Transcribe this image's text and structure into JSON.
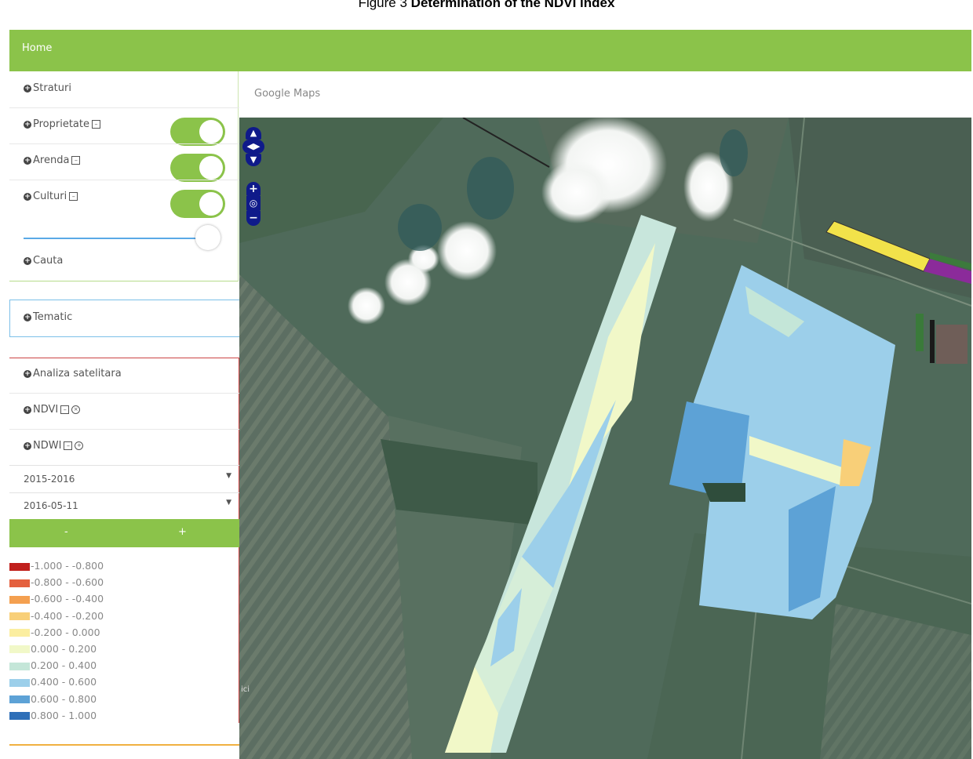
{
  "caption": {
    "prefix": "Figure 3",
    "title": "Determination of the NDVI index"
  },
  "navbar": {
    "home": "Home"
  },
  "sidebar": {
    "straturi": "Straturi",
    "layers": [
      {
        "label": "Proprietate",
        "on": true
      },
      {
        "label": "Arenda",
        "on": true
      },
      {
        "label": "Culturi",
        "on": true
      }
    ],
    "cauta": "Cauta",
    "tematic": "Tematic",
    "analiza": "Analiza satelitara",
    "indices": [
      {
        "label": "NDVI"
      },
      {
        "label": "NDWI"
      }
    ],
    "season": "2015-2016",
    "date": "2016-05-11",
    "btn_minus": "-",
    "btn_plus": "+"
  },
  "legend": [
    {
      "range": "-1.000 - -0.800",
      "color": "#c0201c"
    },
    {
      "range": "-0.800 - -0.600",
      "color": "#e4603e"
    },
    {
      "range": "-0.600 - -0.400",
      "color": "#f4a050"
    },
    {
      "range": "-0.400 - -0.200",
      "color": "#f8cf78"
    },
    {
      "range": "-0.200 - 0.000",
      "color": "#fbeea0"
    },
    {
      "range": "0.000 - 0.200",
      "color": "#f1f8c8"
    },
    {
      "range": "0.200 - 0.400",
      "color": "#c4e6d8"
    },
    {
      "range": "0.400 - 0.600",
      "color": "#9ccfea"
    },
    {
      "range": "0.600 - 0.800",
      "color": "#5da2d6"
    },
    {
      "range": "0.800 - 1.000",
      "color": "#2f6fb8"
    }
  ],
  "map": {
    "title": "Google Maps",
    "attribution": "ici"
  },
  "colors": {
    "accent": "#8bc34a",
    "nav_control": "#0f1a8a"
  }
}
